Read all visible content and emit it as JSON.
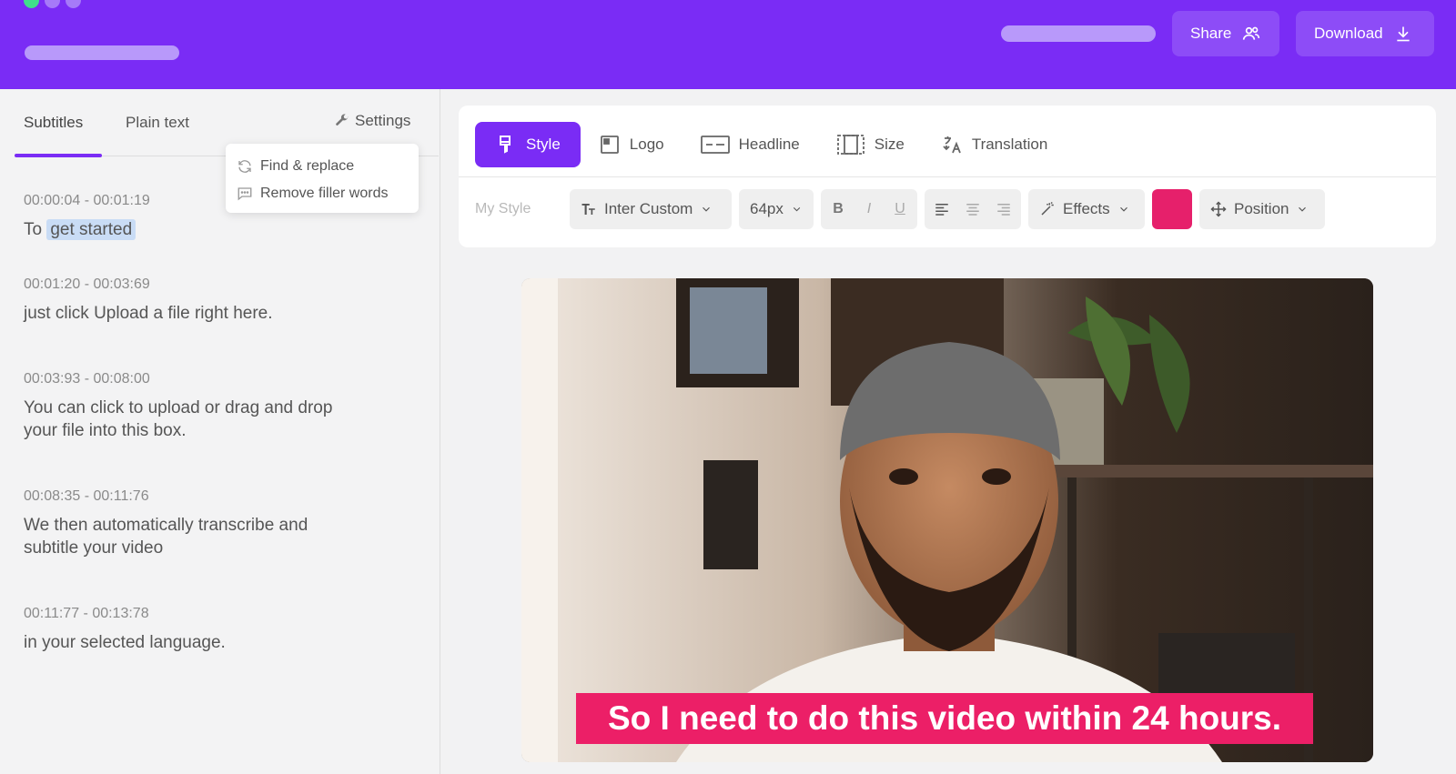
{
  "header": {
    "share_label": "Share",
    "download_label": "Download",
    "share_icon": "users-icon",
    "download_icon": "download-icon"
  },
  "left_panel": {
    "tabs": [
      {
        "label": "Subtitles",
        "active": true
      },
      {
        "label": "Plain text",
        "active": false
      }
    ],
    "settings_label": "Settings",
    "menu": [
      {
        "label": "Find & replace",
        "icon": "refresh-icon"
      },
      {
        "label": "Remove filler words",
        "icon": "comment-icon"
      }
    ],
    "entries": [
      {
        "time": "00:00:04 - 00:01:19",
        "text_prefix": "To ",
        "text_highlight": "get started",
        "text": ""
      },
      {
        "time": "00:01:20 - 00:03:69",
        "text": "just click Upload a file right here."
      },
      {
        "time": "00:03:93 - 00:08:00",
        "text_line1": "You can click to upload or drag and drop",
        "text_line2": "your file into this box."
      },
      {
        "time": "00:08:35 - 00:11:76",
        "text_line1": "We then automatically transcribe and",
        "text_line2": "subtitle your video"
      },
      {
        "time": "00:11:77 - 00:13:78",
        "text": "in your selected language."
      }
    ]
  },
  "toolbar": {
    "tabs": [
      {
        "label": "Style",
        "icon": "brush-icon",
        "active": true
      },
      {
        "label": "Logo",
        "icon": "logo-icon",
        "active": false
      },
      {
        "label": "Headline",
        "icon": "headline-icon",
        "active": false
      },
      {
        "label": "Size",
        "icon": "size-icon",
        "active": false
      },
      {
        "label": "Translation",
        "icon": "translate-icon",
        "active": false
      }
    ],
    "style_name": "My Style",
    "font": "Inter Custom",
    "font_size": "64px",
    "bold": "B",
    "italic": "I",
    "underline": "U",
    "effects_label": "Effects",
    "color": "#e6206b",
    "position_label": "Position"
  },
  "video": {
    "caption": "So I need to do this video within 24 hours."
  },
  "colors": {
    "brand": "#7a2cf5",
    "caption_bg": "#ec1f67"
  }
}
